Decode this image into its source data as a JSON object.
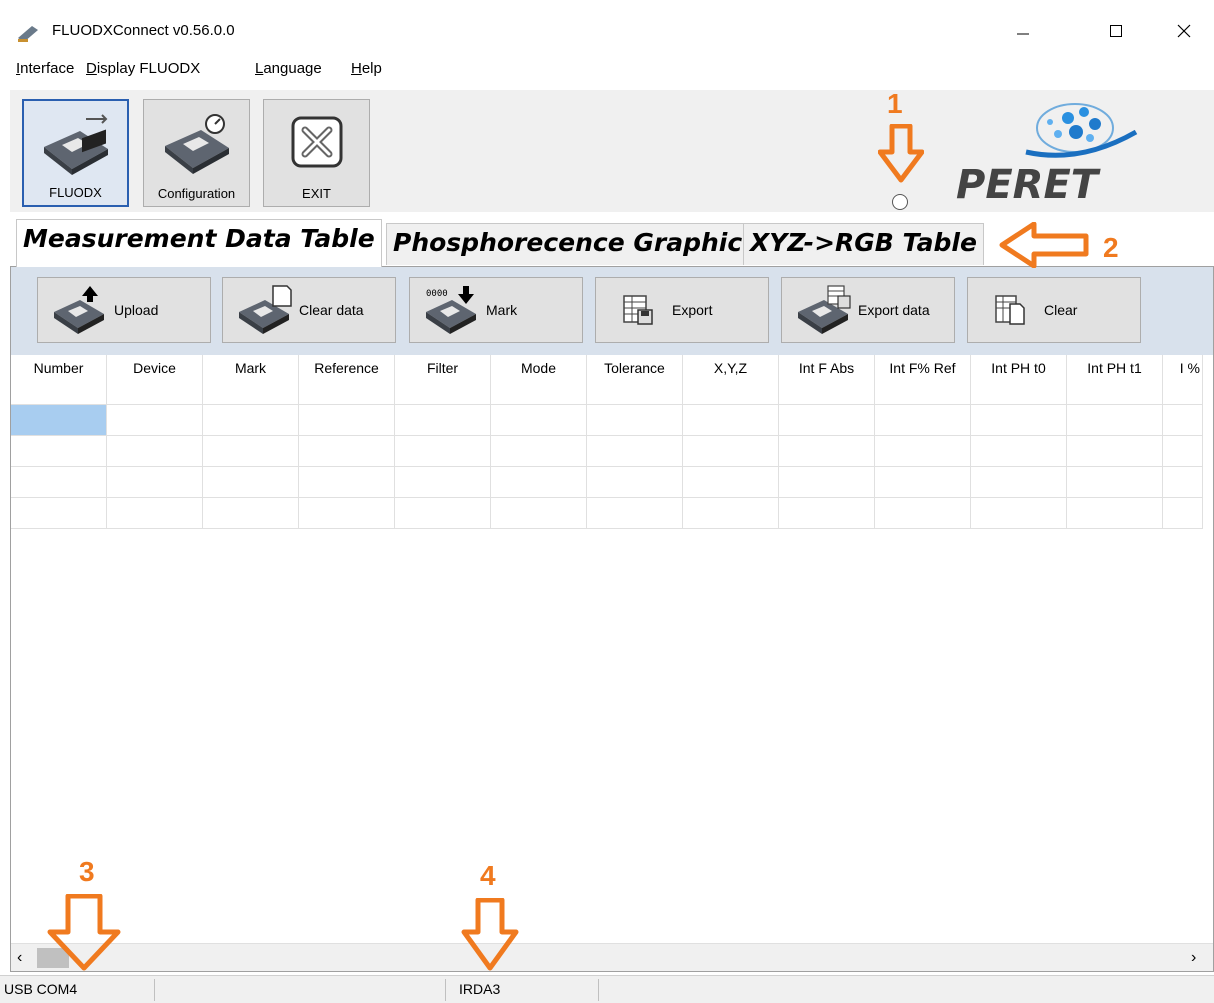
{
  "window": {
    "title": "FLUODXConnect v0.56.0.0",
    "controls": {
      "minimize": "—",
      "maximize": "☐",
      "close": "✕"
    }
  },
  "menu": [
    {
      "mnemonic": "I",
      "rest": "nterface"
    },
    {
      "mnemonic": "D",
      "rest": "isplay FLUODX"
    },
    {
      "mnemonic": "L",
      "rest": "anguage"
    },
    {
      "mnemonic": "H",
      "rest": "elp"
    }
  ],
  "toolbar": {
    "buttons": [
      {
        "label": "FLUODX",
        "icon": "usb-device-icon",
        "active": true
      },
      {
        "label": "Configuration",
        "icon": "gauge-device-icon",
        "active": false
      },
      {
        "label": "EXIT",
        "icon": "exit-x-icon",
        "active": false
      }
    ],
    "logo_text": "PERET"
  },
  "tabs": [
    {
      "label": "Measurement Data Table",
      "selected": true
    },
    {
      "label": "Phosphorecence Graphic",
      "selected": false
    },
    {
      "label": "XYZ->RGB Table",
      "selected": false
    }
  ],
  "actions": [
    {
      "label": "Upload",
      "icon": "upload-device-icon"
    },
    {
      "label": "Clear data",
      "icon": "clear-device-icon"
    },
    {
      "label": "Mark",
      "icon": "mark-device-icon"
    },
    {
      "label": "Export",
      "icon": "export-icon"
    },
    {
      "label": "Export data",
      "icon": "export-data-icon"
    },
    {
      "label": "Clear",
      "icon": "clear-icon"
    }
  ],
  "table": {
    "columns": [
      "Number",
      "Device",
      "Mark",
      "Reference",
      "Filter",
      "Mode",
      "Tolerance",
      "X,Y,Z",
      "Int F Abs",
      "Int F% Ref",
      "Int PH t0",
      "Int PH t1",
      "I %"
    ],
    "rows": [
      [
        "",
        "",
        "",
        "",
        "",
        "",
        "",
        "",
        "",
        "",
        "",
        "",
        ""
      ],
      [
        "",
        "",
        "",
        "",
        "",
        "",
        "",
        "",
        "",
        "",
        "",
        "",
        ""
      ],
      [
        "",
        "",
        "",
        "",
        "",
        "",
        "",
        "",
        "",
        "",
        "",
        "",
        ""
      ],
      [
        "",
        "",
        "",
        "",
        "",
        "",
        "",
        "",
        "",
        "",
        "",
        "",
        ""
      ]
    ]
  },
  "statusbar": {
    "port": "USB COM4",
    "interface": "IRDA3"
  },
  "annotations": [
    "1",
    "2",
    "3",
    "4"
  ],
  "colors": {
    "accent_orange": "#f07a1f",
    "action_bar_bg": "#d8e1ec",
    "selected_cell": "#a8cdf0"
  }
}
